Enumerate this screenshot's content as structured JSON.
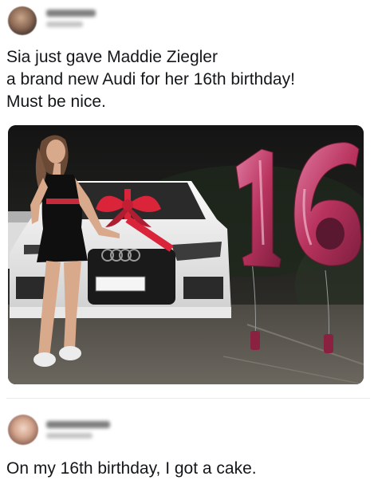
{
  "posts": [
    {
      "avatar_icon": "user-avatar-blurred",
      "author_blurred": true,
      "text": "Sia just gave Maddie Ziegler\na brand new Audi for her 16th birthday!\nMust be nice.",
      "image": {
        "subject": "photo-girl-with-white-audi-and-16-balloons",
        "balloon_number": "16",
        "balloon_color": "#c2406a",
        "car_color": "#f2f2f2",
        "bow_color": "#d9243a"
      }
    },
    {
      "avatar_icon": "user-avatar-blurred",
      "author_blurred": true,
      "text": "On my 16th birthday, I got a cake."
    }
  ],
  "colors": {
    "text": "#14171a",
    "divider": "#e6ecf0",
    "background": "#ffffff"
  }
}
